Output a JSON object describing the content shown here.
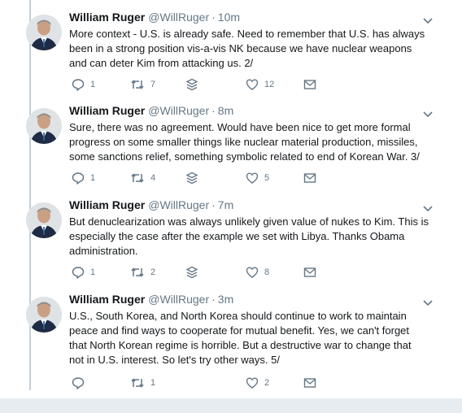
{
  "tweets": [
    {
      "name": "William Ruger",
      "handle": "@WillRuger",
      "time": "10m",
      "text": "More context - U.S. is already safe.  Need to remember that U.S. has always\nbeen in a strong position vis-a-vis NK because we have nuclear weapons\nand can deter Kim from attacking us. 2/",
      "replies": "1",
      "retweets": "7",
      "likes": "12"
    },
    {
      "name": "William Ruger",
      "handle": "@WillRuger",
      "time": "8m",
      "text": "Sure, there was no agreement.  Would have been nice to get more formal\nprogress on some smaller things like nuclear material production, missiles,\nsome sanctions relief, something symbolic related to end of Korean War.  3/",
      "replies": "1",
      "retweets": "4",
      "likes": "5"
    },
    {
      "name": "William Ruger",
      "handle": "@WillRuger",
      "time": "7m",
      "text": "But denuclearization was always unlikely given value of nukes to Kim.  This is\nespecially the case after the example we set with Libya.  Thanks Obama\nadministration.",
      "replies": "1",
      "retweets": "2",
      "likes": "8"
    },
    {
      "name": "William Ruger",
      "handle": "@WillRuger",
      "time": "3m",
      "text": "U.S., South Korea, and North Korea should continue to work to maintain\npeace and find ways to cooperate for mutual benefit.  Yes, we can't forget\nthat North Korean regime is horrible.  But a destructive war to change that\nnot in U.S. interest.  So let's try other ways.  5/",
      "replies": "",
      "retweets": "1",
      "likes": "2"
    }
  ],
  "separator": "·",
  "icons": [
    "reply-icon",
    "retweet-icon",
    "like-icon",
    "stack-icon",
    "envelope-icon",
    "chevron-down-icon"
  ],
  "colors": {
    "text": "#14171a",
    "muted": "#657786",
    "thread_line": "#c4cfd6"
  }
}
